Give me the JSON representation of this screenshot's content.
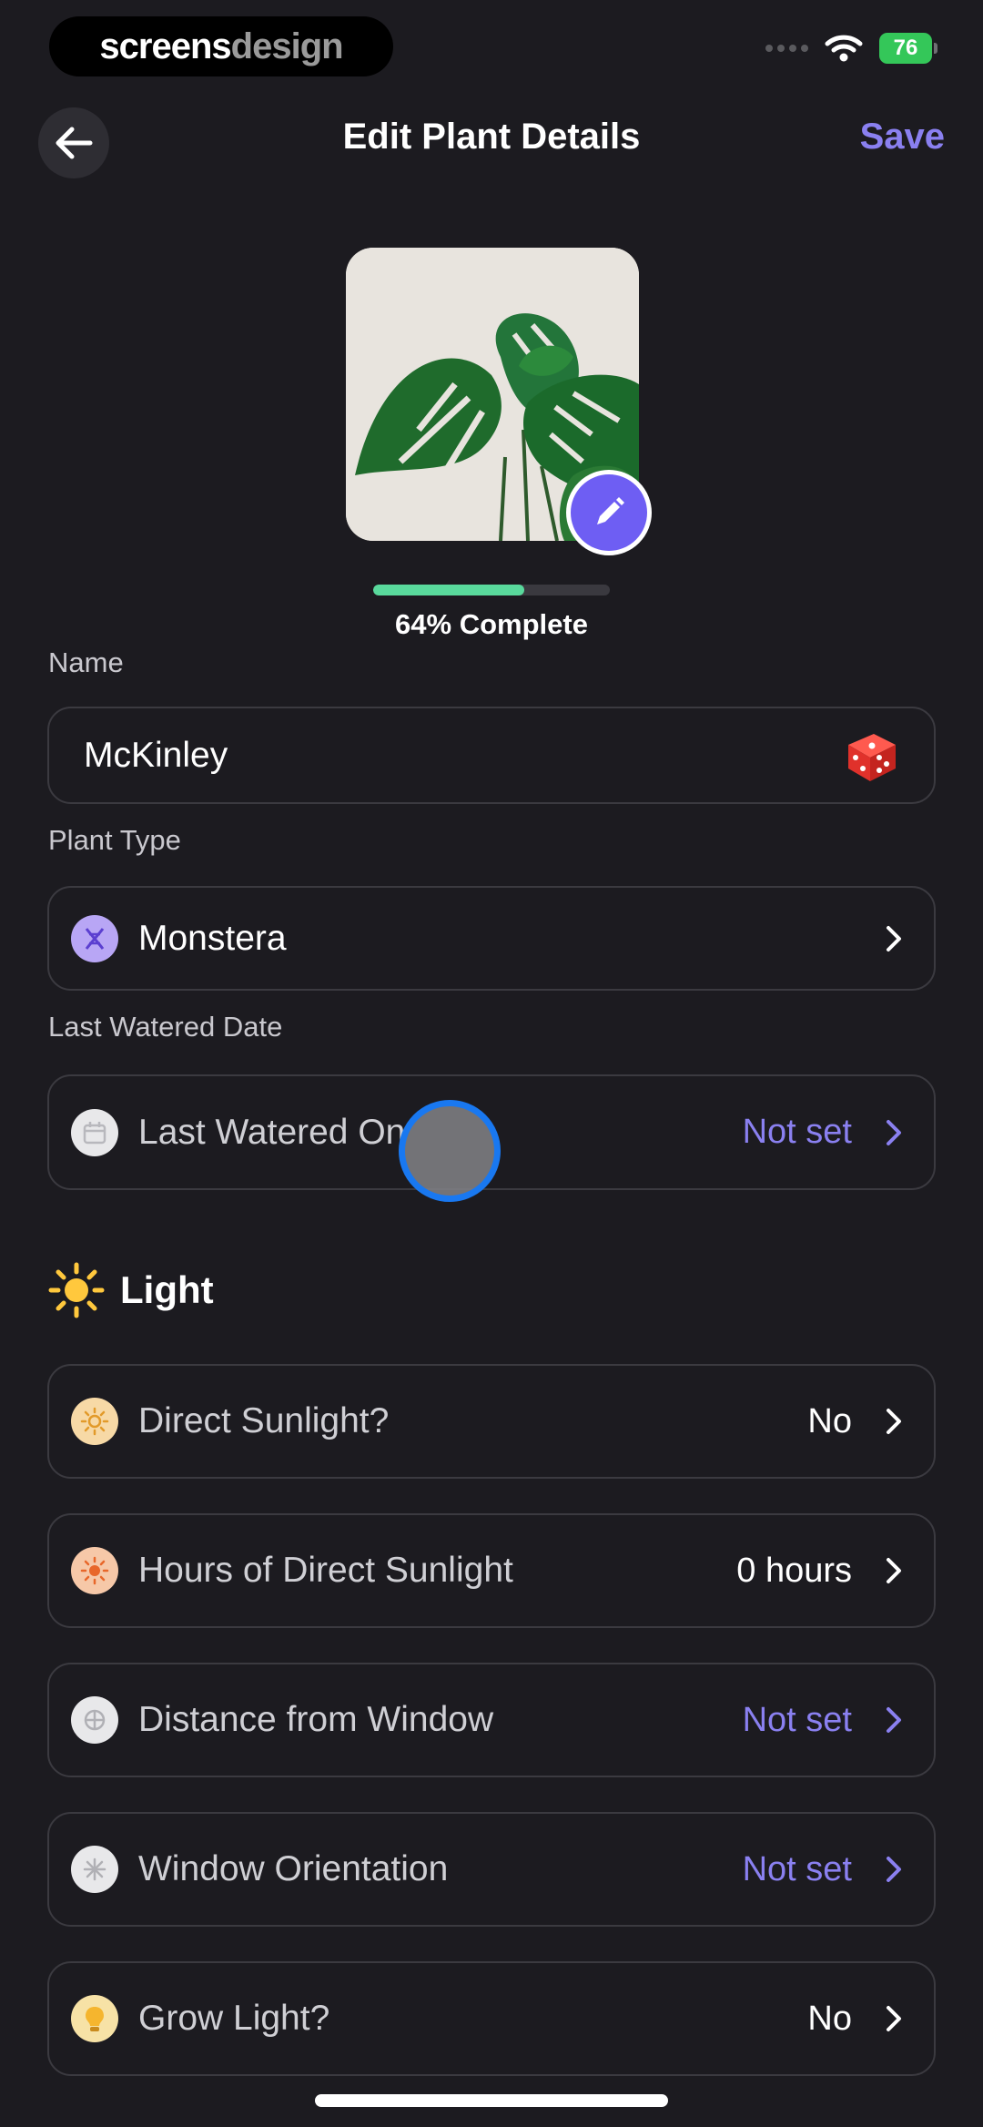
{
  "status_bar": {
    "watermark_part1": "screens",
    "watermark_part2": "design",
    "battery": "76"
  },
  "header": {
    "title": "Edit Plant Details",
    "save_label": "Save"
  },
  "photo": {
    "progress_fraction": 0.64,
    "progress_label": "64% Complete"
  },
  "form": {
    "name": {
      "label": "Name",
      "value": "McKinley"
    },
    "plant_type": {
      "label": "Plant Type",
      "value": "Monstera"
    },
    "last_watered": {
      "label": "Last Watered Date",
      "row_label": "Last Watered On",
      "value": "Not set"
    }
  },
  "light": {
    "title": "Light",
    "rows": [
      {
        "label": "Direct Sunlight?",
        "value": "No",
        "icon": "sun-icon",
        "value_color": "white"
      },
      {
        "label": "Hours of Direct Sunlight",
        "value": "0 hours",
        "icon": "sun-hours-icon",
        "value_color": "white"
      },
      {
        "label": "Distance from Window",
        "value": "Not set",
        "icon": "window-icon",
        "value_color": "purple"
      },
      {
        "label": "Window Orientation",
        "value": "Not set",
        "icon": "compass-icon",
        "value_color": "purple"
      },
      {
        "label": "Grow Light?",
        "value": "No",
        "icon": "bulb-icon",
        "value_color": "white"
      }
    ]
  },
  "colors": {
    "accent": "#8a80f0",
    "background": "#1c1b20",
    "progress": "#59d99c"
  }
}
